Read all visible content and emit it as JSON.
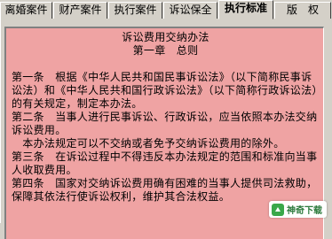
{
  "tabs": [
    {
      "label": "离婚案件",
      "active": false
    },
    {
      "label": "财产案件",
      "active": false
    },
    {
      "label": "执行案件",
      "active": false
    },
    {
      "label": "诉讼保全",
      "active": false
    },
    {
      "label": "执行标准",
      "active": true
    },
    {
      "label": "版　权",
      "active": false
    }
  ],
  "document": {
    "title": "诉讼费用交纳办法",
    "chapter": "第一章　总则",
    "paragraphs": [
      "第一条　根据《中华人民共和国民事诉讼法》（以下简称民事诉讼法）和《中华人民共和国行政诉讼法》（以下简称行政诉讼法）的有关规定，制定本办法。",
      "第二条　当事人进行民事诉讼、行政诉讼，应当依照本办法交纳诉讼费用。",
      "　本办法规定可以不交纳或者免予交纳诉讼费用的除外。",
      "第三条　在诉讼过程中不得违反本办法规定的范围和标准向当事人收取费用。",
      "第四条　国家对交纳诉讼费用确有困难的当事人提供司法救助，保障其依法行使诉讼权利，维护其合法权益。"
    ]
  },
  "watermark": {
    "text": "神奇下载"
  }
}
